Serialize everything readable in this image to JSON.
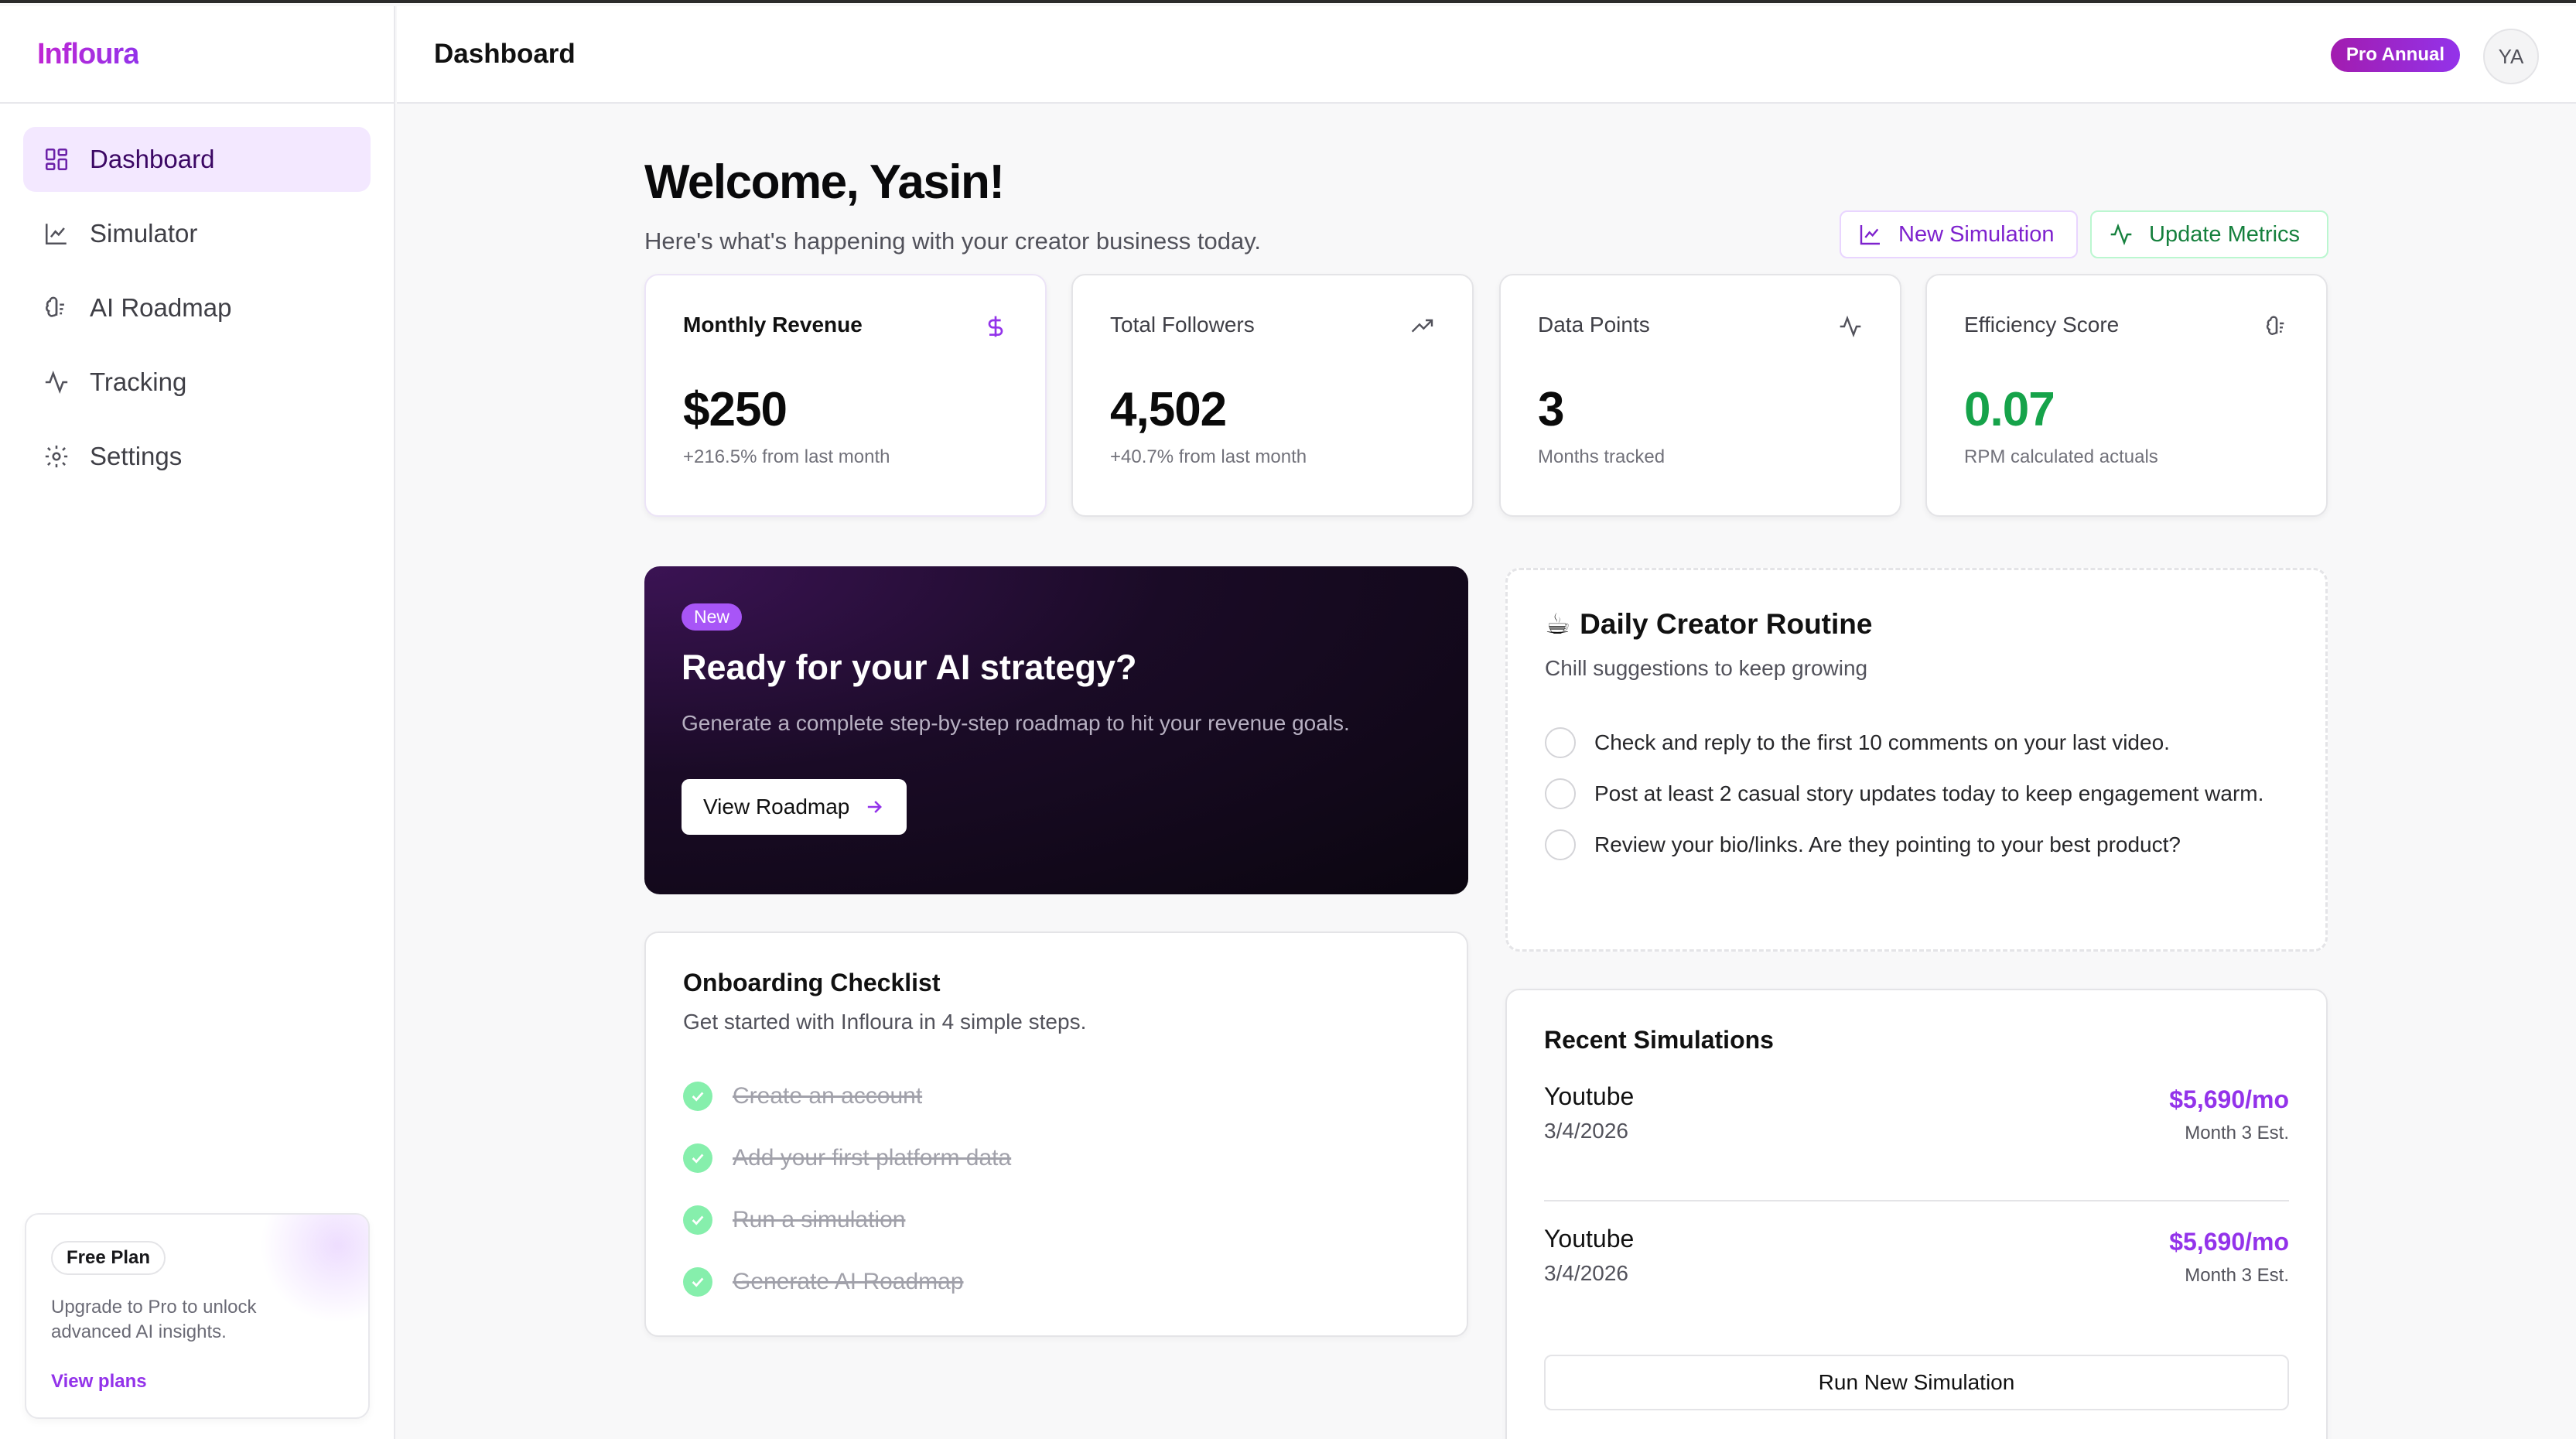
{
  "app": {
    "logo": "Infloura",
    "page_title": "Dashboard"
  },
  "header": {
    "plan_badge": "Pro Annual",
    "avatar_initials": "YA"
  },
  "sidebar": {
    "items": [
      {
        "label": "Dashboard",
        "icon": "grid-icon",
        "active": true
      },
      {
        "label": "Simulator",
        "icon": "line-chart-icon"
      },
      {
        "label": "AI Roadmap",
        "icon": "brain-icon"
      },
      {
        "label": "Tracking",
        "icon": "activity-icon"
      },
      {
        "label": "Settings",
        "icon": "gear-icon"
      }
    ],
    "plan_card": {
      "badge": "Free Plan",
      "text": "Upgrade to Pro to unlock advanced AI insights.",
      "link": "View plans"
    }
  },
  "main": {
    "welcome": "Welcome, Yasin!",
    "subtitle": "Here's what's happening with your creator business today.",
    "actions": {
      "new_simulation": "New Simulation",
      "update_metrics": "Update Metrics"
    },
    "stats": [
      {
        "label": "Monthly Revenue",
        "value": "$250",
        "sub": "+216.5% from last month",
        "icon": "dollar-icon"
      },
      {
        "label": "Total Followers",
        "value": "4,502",
        "sub": "+40.7% from last month",
        "icon": "trending-up-icon"
      },
      {
        "label": "Data Points",
        "value": "3",
        "sub": "Months tracked",
        "icon": "activity-icon"
      },
      {
        "label": "Efficiency Score",
        "value": "0.07",
        "sub": "RPM calculated actuals",
        "icon": "brain-icon",
        "value_color": "#16a34a"
      }
    ],
    "ai_card": {
      "badge": "New",
      "title": "Ready for your AI strategy?",
      "description": "Generate a complete step-by-step roadmap to hit your revenue goals.",
      "button": "View Roadmap"
    },
    "onboarding": {
      "title": "Onboarding Checklist",
      "subtitle": "Get started with Infloura in 4 simple steps.",
      "items": [
        "Create an account",
        "Add your first platform data",
        "Run a simulation",
        "Generate AI Roadmap"
      ]
    },
    "routine": {
      "icon": "☕",
      "title": "Daily Creator Routine",
      "subtitle": "Chill suggestions to keep growing",
      "items": [
        "Check and reply to the first 10 comments on your last video.",
        "Post at least 2 casual story updates today to keep engagement warm.",
        "Review your bio/links. Are they pointing to your best product?"
      ]
    },
    "recent": {
      "title": "Recent Simulations",
      "rows": [
        {
          "name": "Youtube",
          "date": "3/4/2026",
          "amount": "$5,690/mo",
          "note": "Month 3 Est."
        },
        {
          "name": "Youtube",
          "date": "3/4/2026",
          "amount": "$5,690/mo",
          "note": "Month 3 Est."
        }
      ],
      "button": "Run New Simulation"
    }
  },
  "colors": {
    "accent": "#9333ea",
    "positive": "#16a34a"
  }
}
